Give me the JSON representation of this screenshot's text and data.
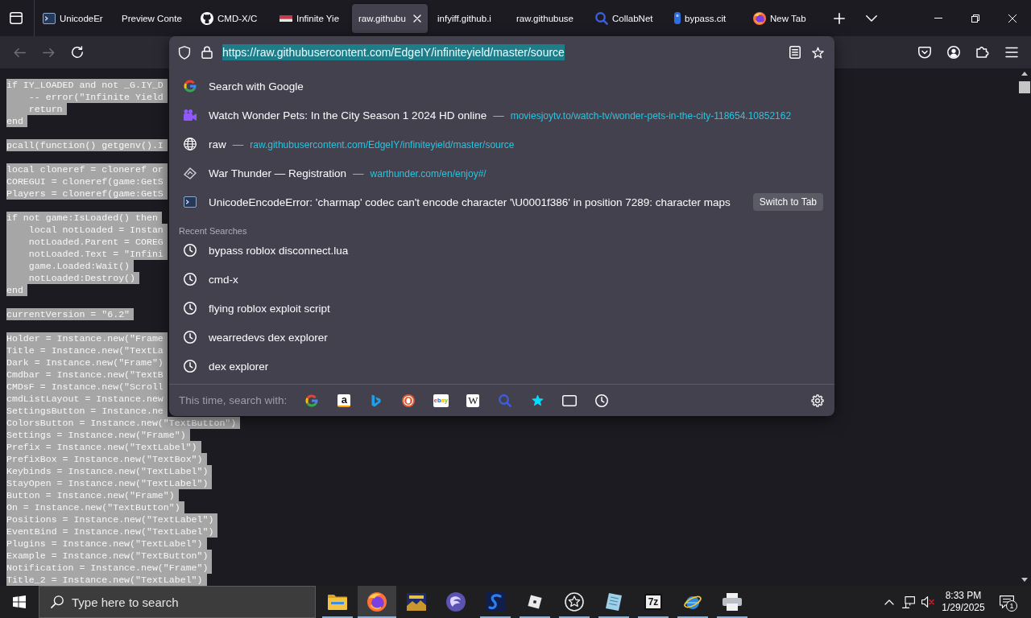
{
  "tabs": [
    {
      "title": "UnicodeEr",
      "kind": "terminal",
      "selected": false
    },
    {
      "title": "Preview Conte",
      "kind": "plain",
      "selected": false
    },
    {
      "title": "CMD-X/C",
      "kind": "octo",
      "selected": false
    },
    {
      "title": "Infinite Yie",
      "kind": "banner",
      "selected": false
    },
    {
      "title": "raw.githubu",
      "kind": "plain",
      "selected": true
    },
    {
      "title": "infyiff.github.i",
      "kind": "plain",
      "selected": false
    },
    {
      "title": "raw.githubuse",
      "kind": "plain",
      "selected": false
    },
    {
      "title": "CollabNet",
      "kind": "magnifier",
      "selected": false
    },
    {
      "title": "bypass.cit",
      "kind": "capsule",
      "selected": false
    },
    {
      "title": "New Tab",
      "kind": "fox",
      "selected": false
    }
  ],
  "navigation": {
    "back_enabled": false,
    "forward_enabled": false
  },
  "address_bar": {
    "url": "https://raw.githubusercontent.com/EdgeIY/infiniteyield/master/source",
    "url_selected": true
  },
  "suggestions": [
    {
      "kind": "search",
      "title": "Search with Google",
      "selected": false
    },
    {
      "kind": "video",
      "title": "Watch Wonder Pets: In the City Season 1 2024 HD online",
      "separator": "—",
      "url": "moviesjoytv.to/watch-tv/wonder-pets-in-the-city-118654.10852162",
      "selected": false
    },
    {
      "kind": "globe",
      "title": "raw",
      "separator": "—",
      "url": "raw.githubusercontent.com/EdgeIY/infiniteyield/master/source",
      "selected": false
    },
    {
      "kind": "emblem",
      "title": "War Thunder — Registration",
      "separator": "—",
      "url": "warthunder.com/en/enjoy#/",
      "selected": false
    },
    {
      "kind": "terminal",
      "title": "UnicodeEncodeError: 'charmap' codec can't encode character '\\U0001f386' in position 7289: character maps",
      "action": "Switch to Tab",
      "selected": false
    }
  ],
  "recent_searches": {
    "heading": "Recent Searches",
    "items": [
      {
        "text": "bypass roblox disconnect.lua",
        "selected": false
      },
      {
        "text": "cmd-x",
        "selected": false
      },
      {
        "text": "flying roblox exploit script",
        "selected": false
      },
      {
        "text": "wearredevs dex explorer",
        "selected": false
      },
      {
        "text": "dex explorer",
        "selected": false
      }
    ]
  },
  "search_footer": {
    "label": "This time, search with:",
    "engines": [
      {
        "kind": "google"
      },
      {
        "kind": "amazon",
        "glyph": "a"
      },
      {
        "kind": "bing"
      },
      {
        "kind": "duck"
      },
      {
        "kind": "ebay",
        "glyph": "ebay"
      },
      {
        "kind": "wiki",
        "glyph": "W"
      },
      {
        "kind": "magnifier"
      },
      {
        "kind": "bookmarks"
      },
      {
        "kind": "tabs"
      },
      {
        "kind": "history"
      }
    ]
  },
  "page": {
    "highlighted": true,
    "blocks": [
      [
        "if IY_LOADED and not _G.IY_D",
        "    -- error(\"Infinite Yield",
        "    return",
        "end"
      ],
      [
        "pcall(function() getgenv().I"
      ],
      [
        "local cloneref = cloneref or",
        "COREGUI = cloneref(game:GetS",
        "Players = cloneref(game:GetS"
      ],
      [
        "if not game:IsLoaded() then",
        "    local notLoaded = Instan",
        "    notLoaded.Parent = COREG",
        "    notLoaded.Text = \"Infini",
        "    game.Loaded:Wait()",
        "    notLoaded:Destroy()",
        "end"
      ],
      [
        "currentVersion = \"6.2\""
      ],
      [
        "Holder = Instance.new(\"Frame",
        "Title = Instance.new(\"TextLa",
        "Dark = Instance.new(\"Frame\")",
        "Cmdbar = Instance.new(\"TextB",
        "CMDsF = Instance.new(\"Scroll",
        "cmdListLayout = Instance.new",
        "SettingsButton = Instance.ne",
        "ColorsButton = Instance.new(\"TextButton\")",
        "Settings = Instance.new(\"Frame\")",
        "Prefix = Instance.new(\"TextLabel\")",
        "PrefixBox = Instance.new(\"TextBox\")",
        "Keybinds = Instance.new(\"TextLabel\")",
        "StayOpen = Instance.new(\"TextLabel\")",
        "Button = Instance.new(\"Frame\")",
        "On = Instance.new(\"TextButton\")",
        "Positions = Instance.new(\"TextLabel\")",
        "EventBind = Instance.new(\"TextLabel\")",
        "Plugins = Instance.new(\"TextLabel\")",
        "Example = Instance.new(\"TextButton\")",
        "Notification = Instance.new(\"Frame\")",
        "Title_2 = Instance.new(\"TextLabel\")"
      ]
    ]
  },
  "taskbar": {
    "search_placeholder": "Type here to search",
    "apps": [
      {
        "kind": "folder",
        "active": false,
        "running": true
      },
      {
        "kind": "browser",
        "active": true,
        "running": true
      },
      {
        "kind": "picture",
        "active": false,
        "running": false
      },
      {
        "kind": "sphere",
        "active": false,
        "running": false
      },
      {
        "kind": "swirl",
        "active": false,
        "running": true
      },
      {
        "kind": "cube",
        "active": false,
        "running": true
      },
      {
        "kind": "star",
        "active": false,
        "running": true
      },
      {
        "kind": "notepad",
        "active": false,
        "running": true
      },
      {
        "kind": "archive",
        "label": "7z",
        "active": false,
        "running": true
      },
      {
        "kind": "orbit",
        "active": false,
        "running": true
      },
      {
        "kind": "printer",
        "active": false,
        "running": true
      }
    ],
    "muted": true,
    "time": "8:33 PM",
    "date": "1/29/2025",
    "notifications": "1"
  }
}
